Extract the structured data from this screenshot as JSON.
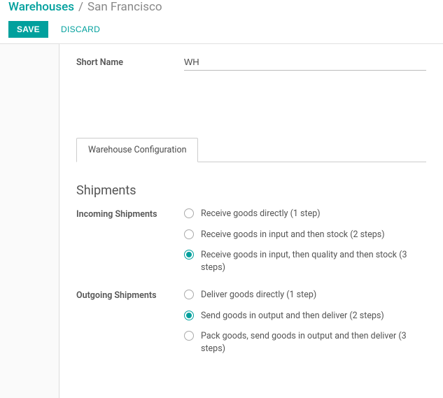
{
  "breadcrumb": {
    "root": "Warehouses",
    "current": "San Francisco"
  },
  "actions": {
    "save": "SAVE",
    "discard": "DISCARD"
  },
  "fields": {
    "short_name_label": "Short Name",
    "short_name_value": "WH"
  },
  "tab_label": "Warehouse Configuration",
  "section_title": "Shipments",
  "incoming": {
    "label": "Incoming Shipments",
    "options": [
      {
        "label": "Receive goods directly (1 step)",
        "selected": false
      },
      {
        "label": "Receive goods in input and then stock (2 steps)",
        "selected": false
      },
      {
        "label": "Receive goods in input, then quality and then stock (3 steps)",
        "selected": true
      }
    ]
  },
  "outgoing": {
    "label": "Outgoing Shipments",
    "options": [
      {
        "label": "Deliver goods directly (1 step)",
        "selected": false
      },
      {
        "label": "Send goods in output and then deliver (2 steps)",
        "selected": true
      },
      {
        "label": "Pack goods, send goods in output and then deliver (3 steps)",
        "selected": false
      }
    ]
  }
}
